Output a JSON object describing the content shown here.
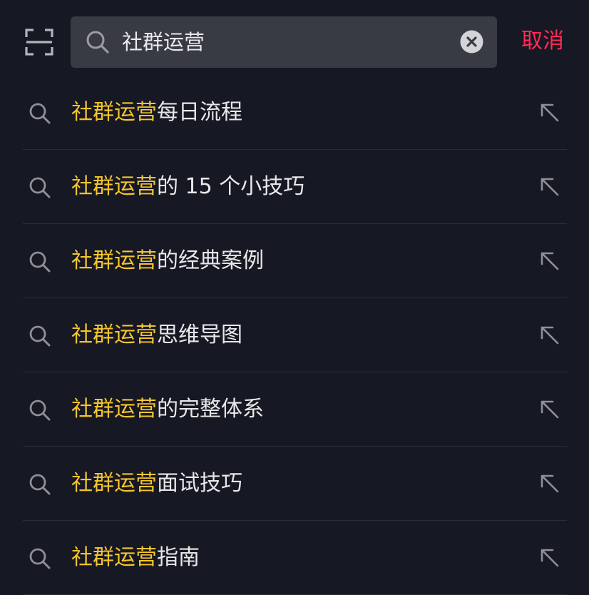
{
  "search": {
    "query": "社群运营",
    "cancel_label": "取消"
  },
  "suggestions": [
    {
      "highlight": "社群运营",
      "rest": "每日流程"
    },
    {
      "highlight": "社群运营",
      "rest": "的 15 个小技巧"
    },
    {
      "highlight": "社群运营",
      "rest": "的经典案例"
    },
    {
      "highlight": "社群运营",
      "rest": "思维导图"
    },
    {
      "highlight": "社群运营",
      "rest": "的完整体系"
    },
    {
      "highlight": "社群运营",
      "rest": "面试技巧"
    },
    {
      "highlight": "社群运营",
      "rest": "指南"
    }
  ],
  "colors": {
    "background": "#161823",
    "search_box": "#393b44",
    "highlight": "#f5c52e",
    "cancel": "#fe2c55",
    "text": "#e8e8ea"
  },
  "icons": {
    "scan": "scan-icon",
    "search": "search-icon",
    "clear": "clear-icon",
    "fill_in": "arrow-up-left-icon"
  }
}
